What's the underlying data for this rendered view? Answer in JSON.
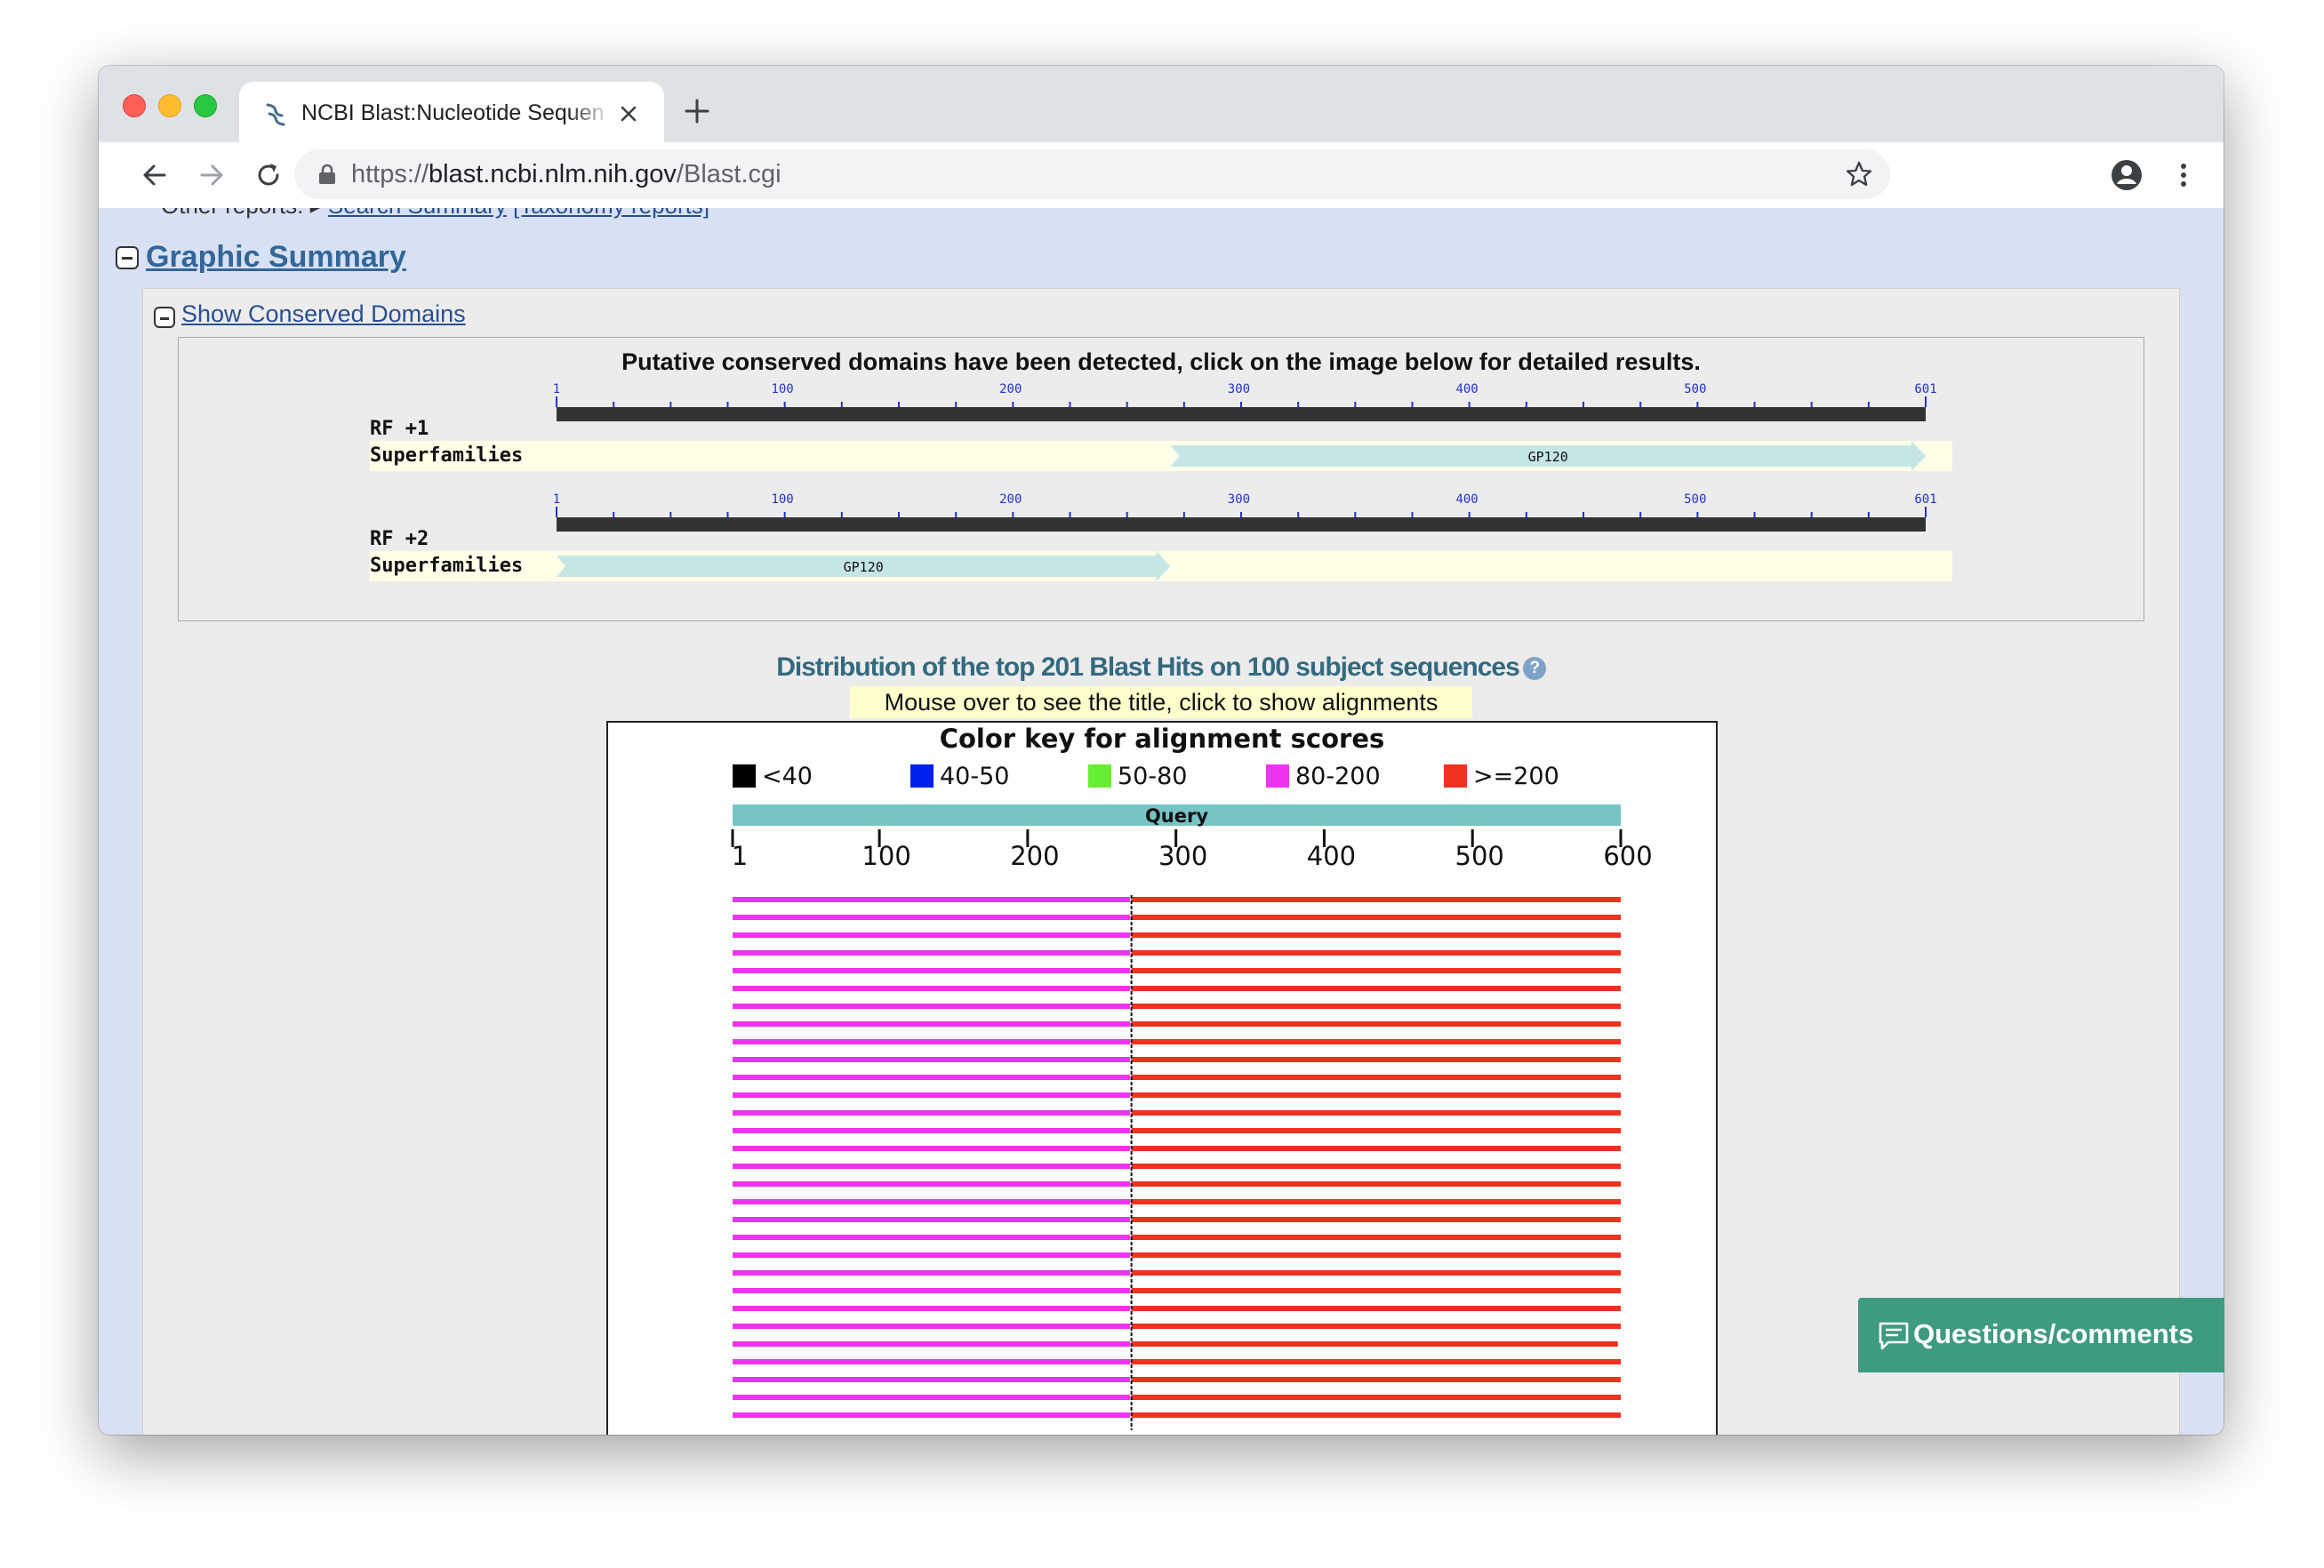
{
  "browser": {
    "tab_title": "NCBI Blast:Nucleotide Sequence",
    "url_scheme": "https://",
    "url_host": "blast.ncbi.nlm.nih.gov",
    "url_path": "/Blast.cgi",
    "icons": [
      "back-icon",
      "forward-icon",
      "reload-icon",
      "lock-icon",
      "star-icon",
      "account-icon",
      "menu-icon",
      "close-icon",
      "new-tab-icon"
    ]
  },
  "page": {
    "cutoff_prefix": "Other reports:",
    "cutoff_link_1": "Search Summary",
    "cutoff_link_2": "[Taxonomy reports]",
    "graphic_summary_title": "Graphic Summary",
    "conserved_domains_link": "Show Conserved Domains",
    "cdd_heading": "Putative conserved domains have been detected, click on the image below for detailed results.",
    "distribution_title": "Distribution of the top 201 Blast Hits on 100 subject sequences",
    "mouse_hint": "Mouse over to see the title, click to show alignments",
    "questions_button": "Questions/comments"
  },
  "cdd_tracks": [
    {
      "label": "RF +1",
      "superfamilies_label": "Superfamilies",
      "domain": {
        "name": "GP120",
        "start": 270,
        "end": 601
      }
    },
    {
      "label": "RF +2",
      "superfamilies_label": "Superfamilies",
      "domain": {
        "name": "GP120",
        "start": 1,
        "end": 270
      }
    }
  ],
  "cdd_ruler": {
    "min": 1,
    "max": 601,
    "labels": [
      1,
      100,
      200,
      300,
      400,
      500,
      601
    ]
  },
  "hits_graphic": {
    "color_key_title": "Color key for alignment scores",
    "legend": [
      {
        "label": "<40",
        "color": "#000000"
      },
      {
        "label": "40-50",
        "color": "#0020ee"
      },
      {
        "label": "50-80",
        "color": "#66ee33"
      },
      {
        "label": "80-200",
        "color": "#ee33ee"
      },
      {
        "label": ">=200",
        "color": "#ee3322"
      }
    ],
    "query_label": "Query",
    "query_length": 600,
    "ticks": [
      1,
      100,
      200,
      300,
      400,
      500,
      600
    ],
    "hit_rows": [
      {
        "segments": [
          {
            "start": 1,
            "end": 269,
            "score_bin": "80-200"
          },
          {
            "start": 270,
            "end": 600,
            "score_bin": ">=200"
          }
        ]
      },
      {
        "segments": [
          {
            "start": 1,
            "end": 269,
            "score_bin": "80-200"
          },
          {
            "start": 270,
            "end": 600,
            "score_bin": ">=200"
          }
        ]
      },
      {
        "segments": [
          {
            "start": 1,
            "end": 269,
            "score_bin": "80-200"
          },
          {
            "start": 270,
            "end": 600,
            "score_bin": ">=200"
          }
        ]
      },
      {
        "segments": [
          {
            "start": 1,
            "end": 269,
            "score_bin": "80-200"
          },
          {
            "start": 270,
            "end": 600,
            "score_bin": ">=200"
          }
        ]
      },
      {
        "segments": [
          {
            "start": 1,
            "end": 269,
            "score_bin": "80-200"
          },
          {
            "start": 270,
            "end": 600,
            "score_bin": ">=200"
          }
        ]
      },
      {
        "segments": [
          {
            "start": 1,
            "end": 269,
            "score_bin": "80-200"
          },
          {
            "start": 270,
            "end": 600,
            "score_bin": ">=200"
          }
        ]
      },
      {
        "segments": [
          {
            "start": 1,
            "end": 269,
            "score_bin": "80-200"
          },
          {
            "start": 270,
            "end": 600,
            "score_bin": ">=200"
          }
        ]
      },
      {
        "segments": [
          {
            "start": 1,
            "end": 269,
            "score_bin": "80-200"
          },
          {
            "start": 270,
            "end": 600,
            "score_bin": ">=200"
          }
        ]
      },
      {
        "segments": [
          {
            "start": 1,
            "end": 269,
            "score_bin": "80-200"
          },
          {
            "start": 270,
            "end": 600,
            "score_bin": ">=200"
          }
        ]
      },
      {
        "segments": [
          {
            "start": 1,
            "end": 269,
            "score_bin": "80-200"
          },
          {
            "start": 270,
            "end": 600,
            "score_bin": ">=200"
          }
        ]
      },
      {
        "segments": [
          {
            "start": 1,
            "end": 269,
            "score_bin": "80-200"
          },
          {
            "start": 270,
            "end": 600,
            "score_bin": ">=200"
          }
        ]
      },
      {
        "segments": [
          {
            "start": 1,
            "end": 269,
            "score_bin": "80-200"
          },
          {
            "start": 270,
            "end": 600,
            "score_bin": ">=200"
          }
        ]
      },
      {
        "segments": [
          {
            "start": 1,
            "end": 269,
            "score_bin": "80-200"
          },
          {
            "start": 270,
            "end": 600,
            "score_bin": ">=200"
          }
        ]
      },
      {
        "segments": [
          {
            "start": 1,
            "end": 269,
            "score_bin": "80-200"
          },
          {
            "start": 270,
            "end": 600,
            "score_bin": ">=200"
          }
        ]
      },
      {
        "segments": [
          {
            "start": 1,
            "end": 269,
            "score_bin": "80-200"
          },
          {
            "start": 270,
            "end": 600,
            "score_bin": ">=200"
          }
        ]
      },
      {
        "segments": [
          {
            "start": 1,
            "end": 269,
            "score_bin": "80-200"
          },
          {
            "start": 270,
            "end": 600,
            "score_bin": ">=200"
          }
        ]
      },
      {
        "segments": [
          {
            "start": 1,
            "end": 269,
            "score_bin": "80-200"
          },
          {
            "start": 270,
            "end": 600,
            "score_bin": ">=200"
          }
        ]
      },
      {
        "segments": [
          {
            "start": 1,
            "end": 269,
            "score_bin": "80-200"
          },
          {
            "start": 270,
            "end": 600,
            "score_bin": ">=200"
          }
        ]
      },
      {
        "segments": [
          {
            "start": 1,
            "end": 269,
            "score_bin": "80-200"
          },
          {
            "start": 270,
            "end": 600,
            "score_bin": ">=200"
          }
        ]
      },
      {
        "segments": [
          {
            "start": 1,
            "end": 269,
            "score_bin": "80-200"
          },
          {
            "start": 270,
            "end": 600,
            "score_bin": ">=200"
          }
        ]
      },
      {
        "segments": [
          {
            "start": 1,
            "end": 269,
            "score_bin": "80-200"
          },
          {
            "start": 270,
            "end": 600,
            "score_bin": ">=200"
          }
        ]
      },
      {
        "segments": [
          {
            "start": 1,
            "end": 269,
            "score_bin": "80-200"
          },
          {
            "start": 270,
            "end": 600,
            "score_bin": ">=200"
          }
        ]
      },
      {
        "segments": [
          {
            "start": 1,
            "end": 269,
            "score_bin": "80-200"
          },
          {
            "start": 270,
            "end": 600,
            "score_bin": ">=200"
          }
        ]
      },
      {
        "segments": [
          {
            "start": 1,
            "end": 269,
            "score_bin": "80-200"
          },
          {
            "start": 270,
            "end": 600,
            "score_bin": ">=200"
          }
        ]
      },
      {
        "segments": [
          {
            "start": 1,
            "end": 269,
            "score_bin": "80-200"
          },
          {
            "start": 270,
            "end": 600,
            "score_bin": ">=200"
          }
        ]
      },
      {
        "segments": [
          {
            "start": 1,
            "end": 269,
            "score_bin": "80-200"
          },
          {
            "start": 270,
            "end": 598,
            "score_bin": ">=200"
          }
        ]
      },
      {
        "segments": [
          {
            "start": 1,
            "end": 269,
            "score_bin": "80-200"
          },
          {
            "start": 270,
            "end": 600,
            "score_bin": ">=200"
          }
        ]
      },
      {
        "segments": [
          {
            "start": 1,
            "end": 269,
            "score_bin": "80-200"
          },
          {
            "start": 270,
            "end": 600,
            "score_bin": ">=200"
          }
        ]
      },
      {
        "segments": [
          {
            "start": 1,
            "end": 269,
            "score_bin": "80-200"
          },
          {
            "start": 270,
            "end": 600,
            "score_bin": ">=200"
          }
        ]
      },
      {
        "segments": [
          {
            "start": 1,
            "end": 269,
            "score_bin": "80-200"
          },
          {
            "start": 270,
            "end": 600,
            "score_bin": ">=200"
          }
        ]
      }
    ]
  },
  "colors": {
    "accent_link": "#336699",
    "cdd_ruler": "#333333",
    "cdd_track_bg": "#ffffe8",
    "cdd_domain": "#c6e6e6",
    "query_bar": "#77c4c4",
    "questions_bg": "#3f9b80"
  }
}
